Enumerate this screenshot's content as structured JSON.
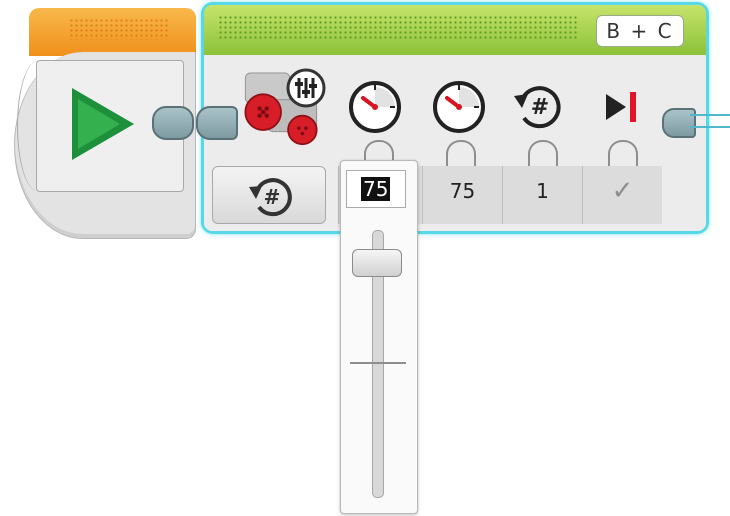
{
  "start_block": {
    "icon": "play-icon",
    "colors": {
      "top": "#f0901c",
      "play": "#1e8f3a"
    }
  },
  "move_block": {
    "ports_label": "B + C",
    "header_color": "#8cc23a",
    "selection_color": "#56d8e6",
    "icons": [
      "tank-motor-icon",
      "mode-settings-icon",
      "left-speed-icon",
      "right-speed-icon",
      "rotations-icon",
      "brake-at-end-icon"
    ],
    "mode_icon": "rotations-mode-icon",
    "params": {
      "left_power": "75",
      "right_power": "75",
      "rotations": "1",
      "brake_at_end": "✓"
    }
  },
  "slider": {
    "value": "75",
    "min": -100,
    "max": 100,
    "position": 75
  }
}
